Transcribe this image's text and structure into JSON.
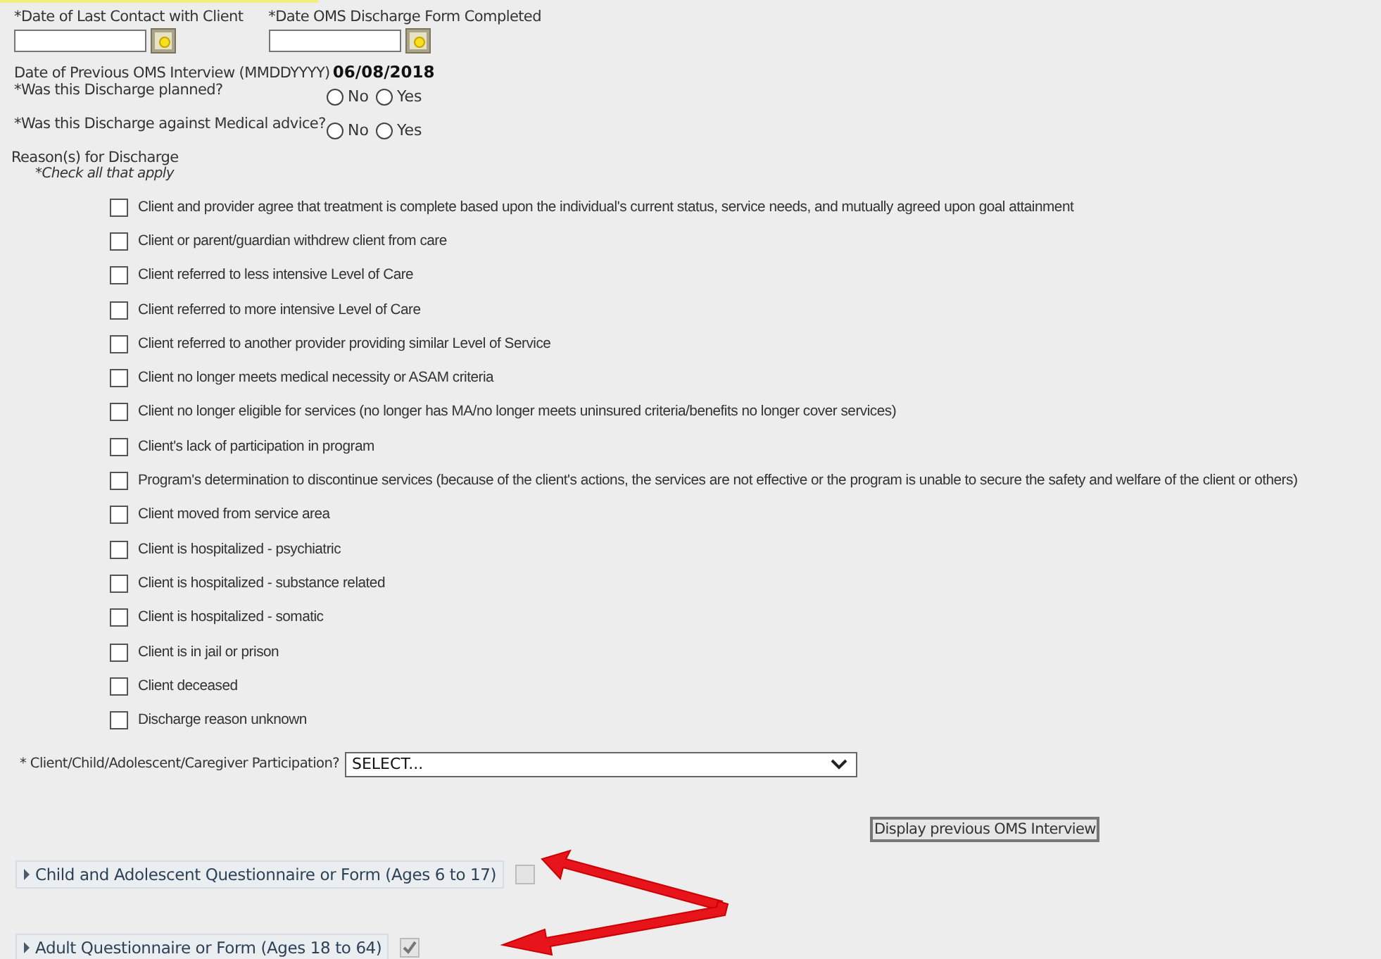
{
  "date_fields": [
    {
      "label": "*Date of Last Contact with Client"
    },
    {
      "label": "*Date OMS Discharge Form Completed"
    }
  ],
  "previous_interview": {
    "label": "Date of Previous OMS Interview (MMDDYYYY)",
    "value": "06/08/2018"
  },
  "questions": [
    {
      "label": "*Was this Discharge planned?",
      "options": [
        {
          "label": "No",
          "selected": false
        },
        {
          "label": "Yes",
          "selected": false
        }
      ]
    },
    {
      "label": "*Was this Discharge against Medical advice?",
      "options": [
        {
          "label": "No",
          "selected": false
        },
        {
          "label": "Yes",
          "selected": false
        }
      ]
    }
  ],
  "reasons": {
    "title": "Reason(s) for Discharge",
    "hint": "*Check all that apply",
    "items": [
      {
        "label": "Client and provider agree that treatment is complete based upon the individual's current status, service needs, and mutually agreed upon goal attainment",
        "checked": false
      },
      {
        "label": "Client or parent/guardian withdrew client from care",
        "checked": false
      },
      {
        "label": "Client referred to less intensive Level of Care",
        "checked": false
      },
      {
        "label": "Client referred to more intensive Level of Care",
        "checked": false
      },
      {
        "label": "Client referred to another provider providing similar Level of Service",
        "checked": false
      },
      {
        "label": "Client no longer meets medical necessity or ASAM criteria",
        "checked": false
      },
      {
        "label": "Client no longer eligible for services (no longer has MA/no longer meets uninsured criteria/benefits no longer cover services)",
        "checked": false
      },
      {
        "label": "Client's lack of participation in program",
        "checked": false
      },
      {
        "label": "Program's determination to discontinue services (because of the client's actions, the services are not effective or the program is unable to secure the safety and welfare of the client or others)",
        "checked": false
      },
      {
        "label": "Client moved from service area",
        "checked": false
      },
      {
        "label": "Client is hospitalized - psychiatric",
        "checked": false
      },
      {
        "label": "Client is hospitalized - substance related",
        "checked": false
      },
      {
        "label": "Client is hospitalized - somatic",
        "checked": false
      },
      {
        "label": "Client is in jail or prison",
        "checked": false
      },
      {
        "label": "Client deceased",
        "checked": false
      },
      {
        "label": "Discharge reason unknown",
        "checked": false
      }
    ]
  },
  "participation": {
    "label": "* Client/Child/Adolescent/Caregiver Participation?",
    "value": "SELECT..."
  },
  "display_button": "Display previous OMS Interview",
  "sections": [
    {
      "label": "Child and Adolescent Questionnaire or Form (Ages 6 to 17)",
      "expanded": false,
      "checked": false
    },
    {
      "label": "Adult Questionnaire or Form (Ages 18 to 64)",
      "expanded": false,
      "checked": true
    }
  ]
}
